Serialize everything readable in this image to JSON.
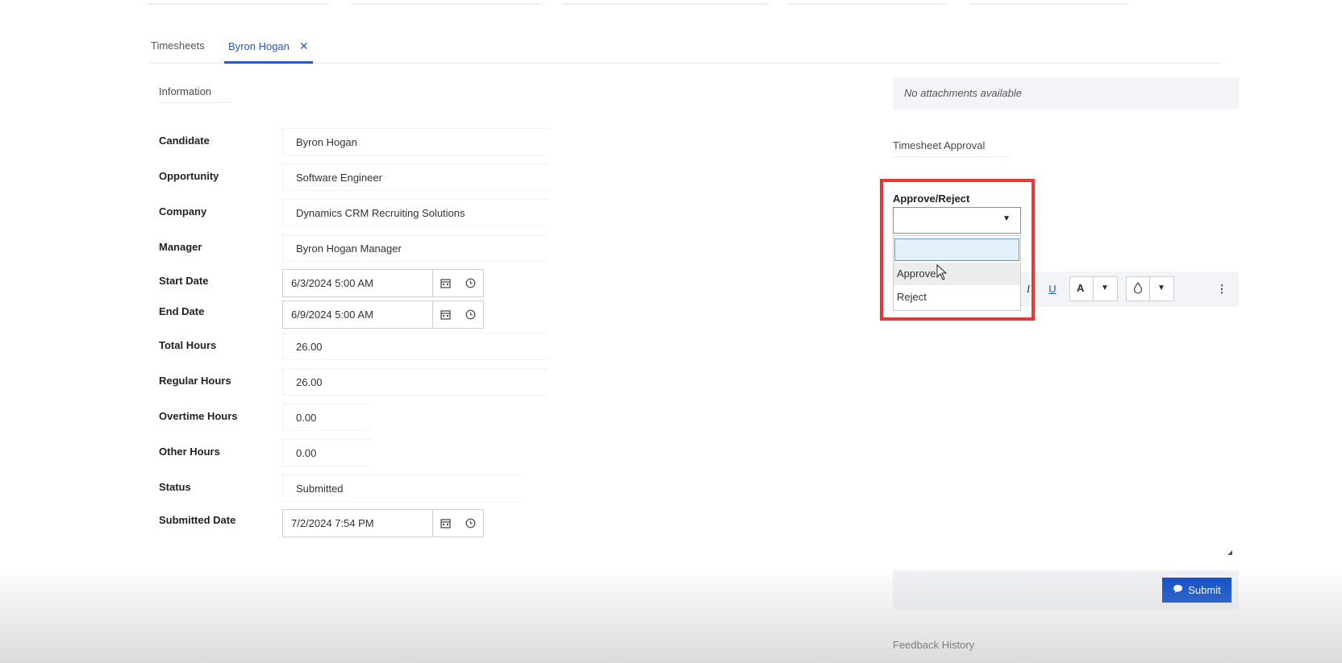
{
  "tabs": [
    {
      "label": "Timesheets"
    },
    {
      "label": "Byron Hogan",
      "close": "✕"
    }
  ],
  "info": {
    "title": "Information"
  },
  "form": {
    "candidate": {
      "label": "Candidate",
      "value": "Byron Hogan"
    },
    "opportunity": {
      "label": "Opportunity",
      "value": "Software Engineer"
    },
    "company": {
      "label": "Company",
      "value": "Dynamics CRM Recruiting Solutions"
    },
    "manager": {
      "label": "Manager",
      "value": "Byron Hogan Manager"
    },
    "start_date": {
      "label": "Start Date",
      "value": "6/3/2024 5:00 AM"
    },
    "end_date": {
      "label": "End Date",
      "value": "6/9/2024 5:00 AM"
    },
    "total_hours": {
      "label": "Total Hours",
      "value": "26.00"
    },
    "regular_hours": {
      "label": "Regular Hours",
      "value": "26.00"
    },
    "overtime_hours": {
      "label": "Overtime Hours",
      "value": "0.00"
    },
    "other_hours": {
      "label": "Other Hours",
      "value": "0.00"
    },
    "status": {
      "label": "Status",
      "value": "Submitted"
    },
    "submitted_date": {
      "label": "Submitted Date",
      "value": "7/2/2024 7:54 PM"
    }
  },
  "attachments": {
    "text": "No attachments available"
  },
  "approval": {
    "section_title": "Timesheet Approval",
    "label": "Approve/Reject",
    "selected": "",
    "options": [
      "Approve",
      "Reject"
    ]
  },
  "toolbar": {
    "italic": "I",
    "underline": "U",
    "font_color": "A",
    "more": "⋮"
  },
  "submit": {
    "label": "Submit"
  },
  "feedback": {
    "title": "Feedback History"
  },
  "icons": {
    "calendar": "calendar-icon",
    "clock": "clock-icon",
    "chat": "chat-icon"
  },
  "colors": {
    "accent": "#2a59c9",
    "submit": "#0b4cc9",
    "highlight_box": "#e53935"
  }
}
